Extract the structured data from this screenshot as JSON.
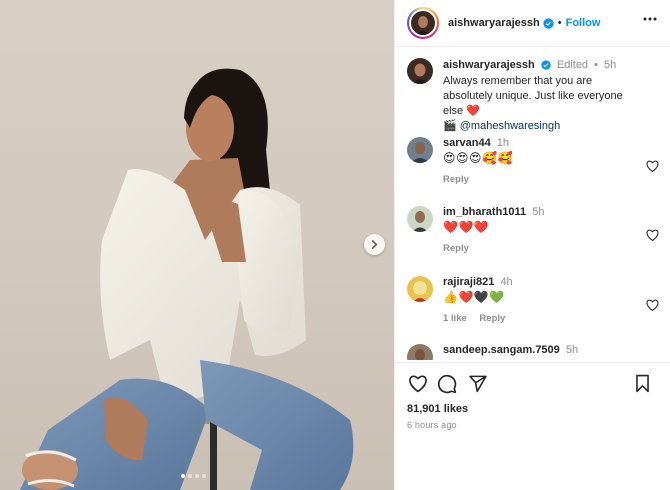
{
  "post": {
    "author": "aishwaryarajessh",
    "follow_label": "Follow",
    "header_separator": "•",
    "icons": {
      "verified": "verified-badge-icon",
      "more": "more-options-icon",
      "next": "chevron-right-icon"
    },
    "media": {
      "slide_count": 4,
      "active_slide": 1,
      "background_color": "#d6cdc2"
    }
  },
  "caption": {
    "username": "aishwaryarajessh",
    "edited": "Edited",
    "sep": "•",
    "time": "5h",
    "line1": "Always remember that you are absolutely unique. Just like everyone else",
    "heart": "❤️",
    "camera": "🎬",
    "mention": "@maheshwaresingh"
  },
  "comments": [
    {
      "username": "sarvan44",
      "time": "1h",
      "emojis": "😍😍😍🥰🥰",
      "actions": [
        "Reply"
      ]
    },
    {
      "username": "im_bharath1011",
      "time": "5h",
      "emojis": "❤️❤️❤️",
      "actions": [
        "Reply"
      ]
    },
    {
      "username": "rajiraji821",
      "time": "4h",
      "emojis": "👍❤️🖤💚",
      "actions": [
        "1 like",
        "Reply"
      ]
    },
    {
      "username": "sandeep.sangam.7509",
      "time": "5h"
    }
  ],
  "footer": {
    "likes": "81,901 likes",
    "ago": "6 hours ago",
    "icons": [
      "heart-icon",
      "comment-icon",
      "share-icon",
      "save-icon"
    ]
  },
  "colors": {
    "link": "#0095f6",
    "mention": "#00376b",
    "muted": "#8e8e8e",
    "verified": "#0095f6"
  }
}
